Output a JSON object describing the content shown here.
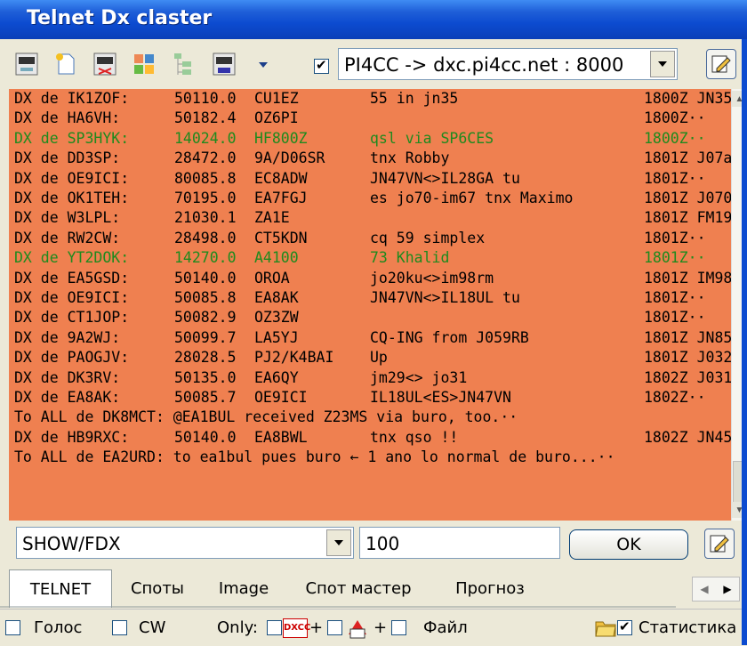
{
  "window": {
    "title": "Telnet Dx claster"
  },
  "toolbar": {
    "icons": [
      "telnet-icon",
      "new-document-icon",
      "telnet-connect-icon",
      "puzzle-icon",
      "tree-icon",
      "telnet-config-icon",
      "dropdown-arrow-icon"
    ],
    "server_checked": true,
    "server": "PI4CC -> dxc.pi4cc.net : 8000"
  },
  "spots": [
    {
      "prefix": "DX de IK1ZOF:",
      "freq": "50110.0",
      "call": "CU1EZ",
      "comment": "55 in jn35",
      "time": "1800Z JN35",
      "color": "black"
    },
    {
      "prefix": "DX de HA6VH:",
      "freq": "50182.4",
      "call": "OZ6PI",
      "comment": "",
      "time": "1800Z··",
      "color": "black"
    },
    {
      "prefix": "DX de SP3HYK:",
      "freq": "14024.0",
      "call": "HF800Z",
      "comment": "qsl via SP6CES",
      "time": "1800Z··",
      "color": "green"
    },
    {
      "prefix": "DX de DD3SP:",
      "freq": "28472.0",
      "call": "9A/D06SR",
      "comment": "tnx Robby",
      "time": "1801Z J07a",
      "color": "black"
    },
    {
      "prefix": "DX de OE9ICI:",
      "freq": "80085.8",
      "call": "EC8ADW",
      "comment": "JN47VN<>IL28GA tu",
      "time": "1801Z··",
      "color": "black"
    },
    {
      "prefix": "DX de OK1TEH:",
      "freq": "70195.0",
      "call": "EA7FGJ",
      "comment": "es jo70-im67 tnx Maximo",
      "time": "1801Z J070",
      "color": "black"
    },
    {
      "prefix": "DX de W3LPL:",
      "freq": "21030.1",
      "call": "ZA1E",
      "comment": "",
      "time": "1801Z FM19",
      "color": "black"
    },
    {
      "prefix": "DX de RW2CW:",
      "freq": "28498.0",
      "call": "CT5KDN",
      "comment": "cq 59 simplex",
      "time": "1801Z··",
      "color": "black"
    },
    {
      "prefix": "DX de YT2DOK:",
      "freq": "14270.0",
      "call": "A4100",
      "comment": "73 Khalid",
      "time": "1801Z··",
      "color": "green"
    },
    {
      "prefix": "DX de EA5GSD:",
      "freq": "50140.0",
      "call": "OROA",
      "comment": "jo20ku<>im98rm",
      "time": "1801Z IM98",
      "color": "black"
    },
    {
      "prefix": "DX de OE9ICI:",
      "freq": "50085.8",
      "call": "EA8AK",
      "comment": "JN47VN<>IL18UL tu",
      "time": "1801Z··",
      "color": "black"
    },
    {
      "prefix": "DX de CT1JOP:",
      "freq": "50082.9",
      "call": "OZ3ZW",
      "comment": "",
      "time": "1801Z··",
      "color": "black"
    },
    {
      "prefix": "DX de 9A2WJ:",
      "freq": "50099.7",
      "call": "LA5YJ",
      "comment": "CQ-ING from J059RB",
      "time": "1801Z JN85",
      "color": "black"
    },
    {
      "prefix": "DX de PAOGJV:",
      "freq": "28028.5",
      "call": "PJ2/K4BAI",
      "comment": "Up",
      "time": "1801Z J032",
      "color": "black"
    },
    {
      "prefix": "DX de DK3RV:",
      "freq": "50135.0",
      "call": "EA6QY",
      "comment": "jm29<> jo31",
      "time": "1802Z J031",
      "color": "black"
    },
    {
      "prefix": "DX de EA8AK:",
      "freq": "50085.7",
      "call": "OE9ICI",
      "comment": "IL18UL<ES>JN47VN",
      "time": "1802Z··",
      "color": "black"
    },
    {
      "full": "To ALL de DK8MCT: @EA1BUL received Z23MS via buro, too.··",
      "color": "black"
    },
    {
      "prefix": "DX de HB9RXC:",
      "freq": "50140.0",
      "call": "EA8BWL",
      "comment": "tnx qso !!",
      "time": "1802Z JN45",
      "color": "black"
    },
    {
      "full": "To ALL de EA2URD: to ea1bul pues buro ← 1 ano lo normal de buro...··",
      "color": "black"
    }
  ],
  "command": {
    "value": "SHOW/FDX",
    "count": "100",
    "ok_label": "OK"
  },
  "tabs": [
    "TELNET",
    "Споты",
    "Image",
    "Спот мастер",
    "Прогноз"
  ],
  "status": {
    "voice_label": "Голос",
    "voice_checked": false,
    "cw_label": "CW",
    "cw_checked": false,
    "only_label": "Only:",
    "only_a_checked": false,
    "plus1": "+",
    "only_b_checked": false,
    "plus2": "+",
    "file_checked": false,
    "file_label": "Файл",
    "stats_checked": true,
    "stats_label": "Статистика"
  },
  "colors": {
    "console_bg": "#ef8050",
    "green_text": "#1e8a1e",
    "titlebar": "#0c4bd0"
  }
}
